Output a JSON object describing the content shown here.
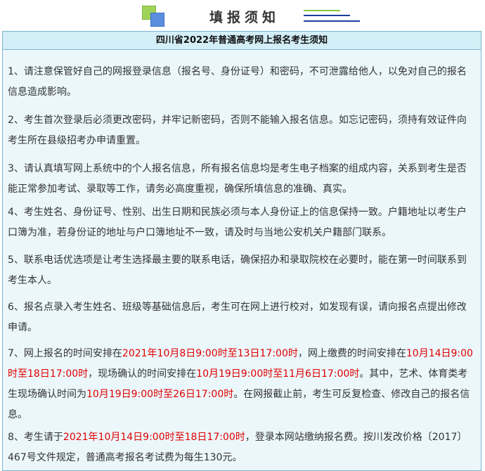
{
  "header": {
    "title": "填报须知",
    "logo_icon": "green-blue-squares-logo"
  },
  "notice": {
    "title": "四川省2022年普通高考网上报名考生须知",
    "items": [
      {
        "parts": [
          "1、请注意保管好自己的网报登录信息（报名号、身份证号）和密码，不可泄露给他人，以免对自己的报名信息造成影响。"
        ]
      },
      {
        "parts": [
          "2、考生首次登录后必须更改密码，并牢记新密码，否则不能输入报名信息。如忘记密码，须持有效证件向考生所在县级招考办申请重置。"
        ]
      },
      {
        "parts": [
          "3、请认真填写网上系统中的个人报名信息，所有报名信息均是考生电子档案的组成内容，关系到考生是否能正常参加考试、录取等工作，请务必高度重视，确保所填信息的准确、真实。"
        ]
      },
      {
        "parts": [
          "4、考生姓名、身份证号、性别、出生日期和民族必须与本人身份证上的信息保持一致。户籍地址以考生户口簿为准，若身份证的地址与户口簿地址不一致，请及时与当地公安机关户籍部门联系。"
        ]
      },
      {
        "parts": [
          "5、联系电话优选项是让考生选择最主要的联系电话，确保招办和录取院校在必要时，能在第一时间联系到考生本人。"
        ]
      },
      {
        "parts": [
          "6、报名点录入考生姓名、班级等基础信息后，考生可在网上进行校对，如发现有误，请向报名点提出修改申请。"
        ]
      },
      {
        "parts": [
          "7、网上报名的时间安排在",
          "2021年10月8日9:00时至13日17:00时",
          "，网上缴费的时间安排在",
          "10月14日9:00时至18日17:00时",
          "，现场确认的时间安排在",
          "10月19日9:00时至11月6日17:00时",
          "。其中，艺术、体育类考生现场确认时间为",
          "10月19日9:00时至26日17:00时",
          "。在网报截止前，考生可反复检查、修改自己的报名信息。"
        ]
      },
      {
        "parts": [
          "8、考生请于",
          "2021年10月14日9:00时至18日17:00时",
          "，登录本网站缴纳报名费。按川发改价格〔2017〕467号文件规定，普通高考报名考试费为每生130元。"
        ]
      }
    ]
  },
  "colors": {
    "highlight": "#e00000",
    "panel_bg": "#ebf7fb",
    "title_bg": "#d3eef7",
    "border": "#7db4cc"
  }
}
